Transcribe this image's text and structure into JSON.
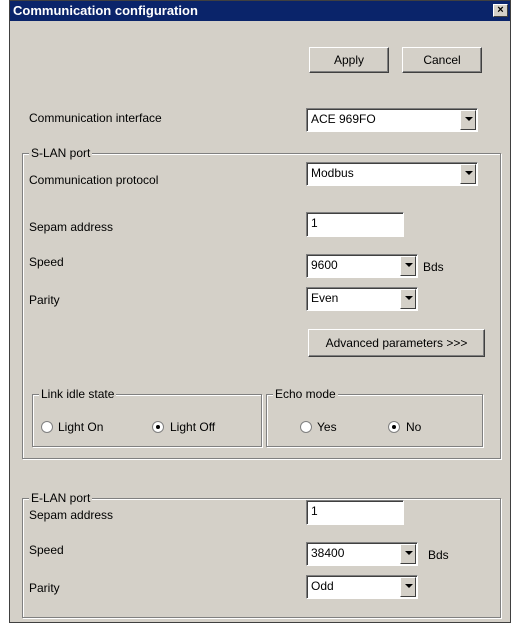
{
  "window": {
    "title": "Communication configuration",
    "close_label": "×"
  },
  "buttons": {
    "apply": "Apply",
    "cancel": "Cancel",
    "advanced": "Advanced parameters >>>"
  },
  "interface": {
    "label": "Communication interface",
    "value": "ACE 969FO"
  },
  "slan": {
    "title": "S-LAN port",
    "protocol_label": "Communication protocol",
    "protocol_value": "Modbus",
    "address_label": "Sepam address",
    "address_value": "1",
    "speed_label": "Speed",
    "speed_value": "9600",
    "speed_unit": "Bds",
    "parity_label": "Parity",
    "parity_value": "Even",
    "link_idle": {
      "title": "Link idle state",
      "opt1": "Light On",
      "opt2": "Light Off",
      "selected": "Light Off"
    },
    "echo": {
      "title": "Echo mode",
      "opt1": "Yes",
      "opt2": "No",
      "selected": "No"
    }
  },
  "elan": {
    "title": "E-LAN port",
    "address_label": "Sepam address",
    "address_value": "1",
    "speed_label": "Speed",
    "speed_value": "38400",
    "speed_unit": "Bds",
    "parity_label": "Parity",
    "parity_value": "Odd"
  }
}
